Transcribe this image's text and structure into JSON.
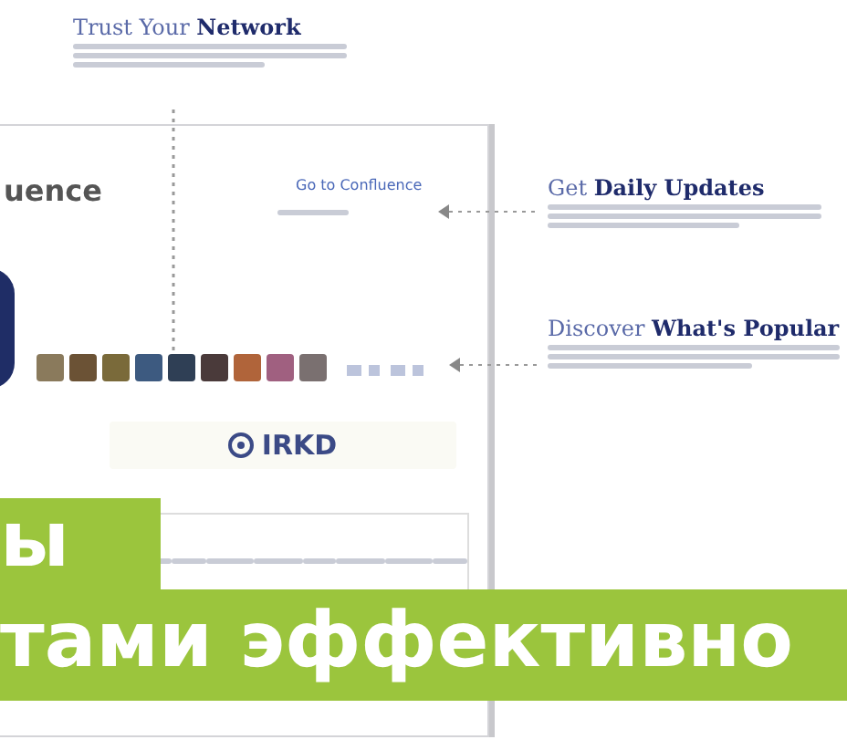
{
  "callouts": [
    {
      "title": "Trust Your **Network**"
    },
    {
      "title": "Get **Daily Updates**"
    },
    {
      "title": "Discover **What's Popular**"
    }
  ],
  "email": {
    "brand": "uence",
    "link": "Go to Confluence",
    "logo": "IRKD"
  },
  "headline": {
    "line_1": "ы",
    "line_2": "тами эффективно"
  }
}
